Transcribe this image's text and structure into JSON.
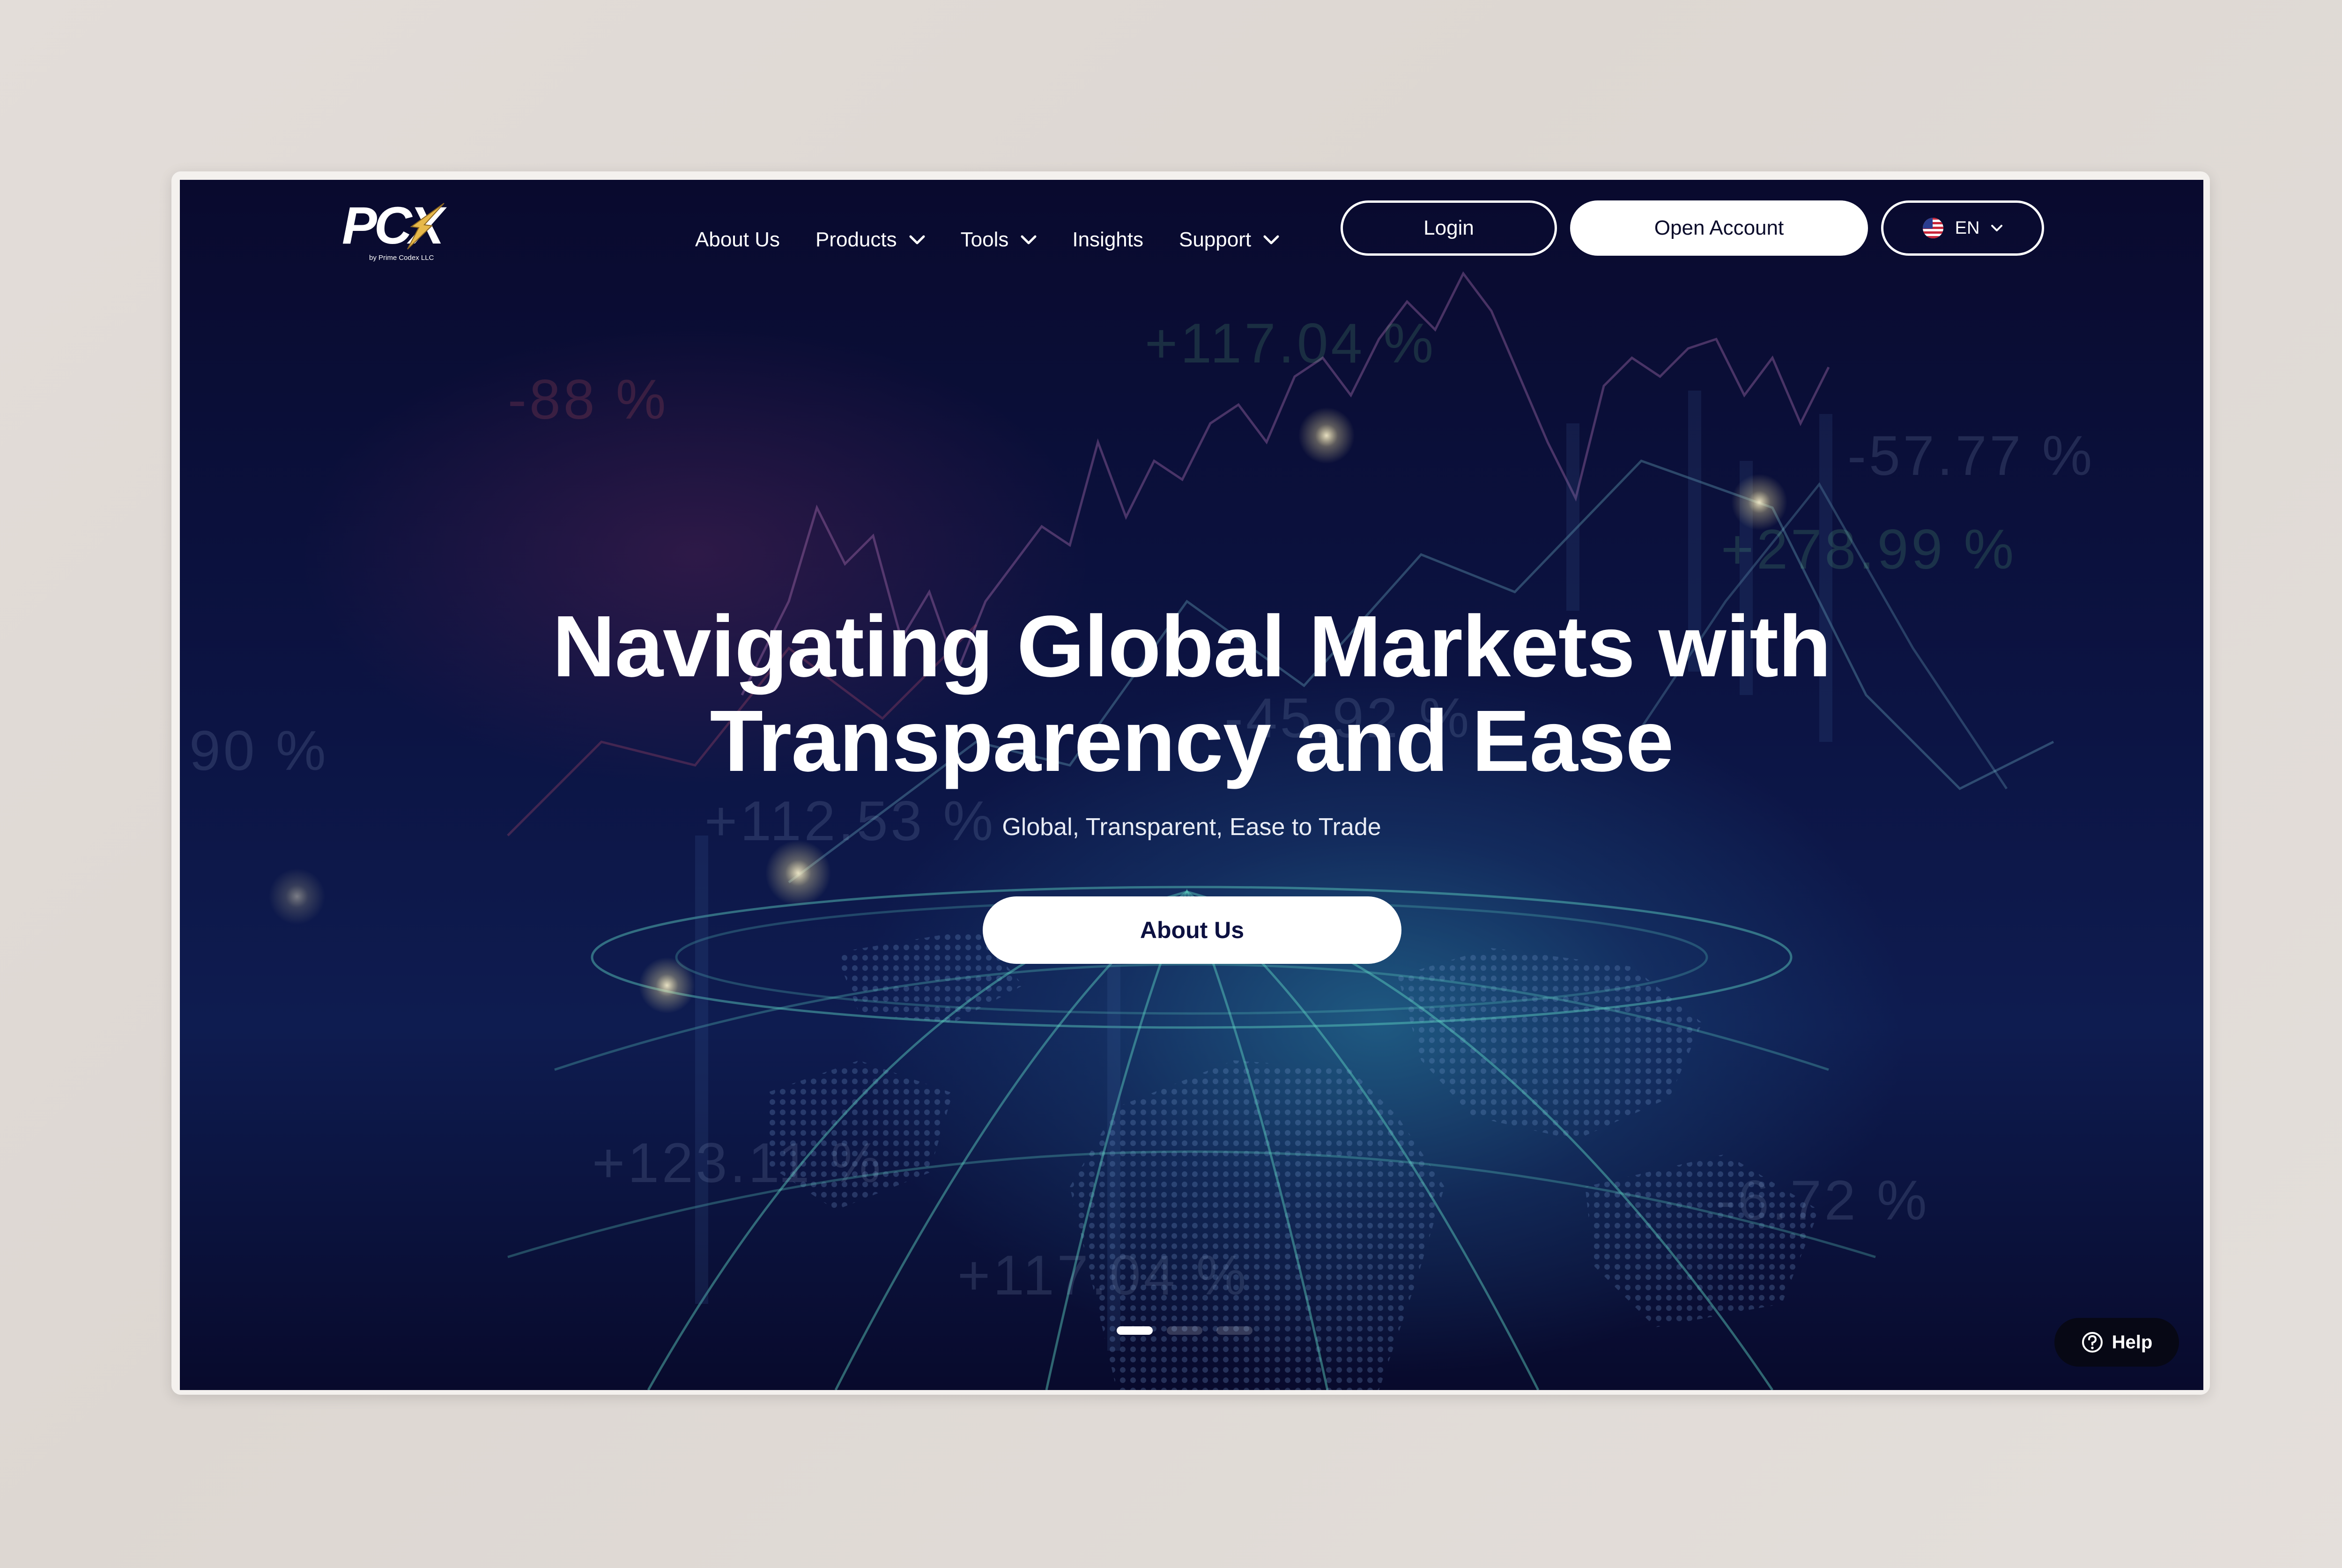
{
  "brand": {
    "logo_text": "PCX",
    "logo_subtitle": "by Prime Codex LLC"
  },
  "nav": {
    "items": [
      {
        "label": "About Us",
        "has_dropdown": false
      },
      {
        "label": "Products",
        "has_dropdown": true
      },
      {
        "label": "Tools",
        "has_dropdown": true
      },
      {
        "label": "Insights",
        "has_dropdown": false
      },
      {
        "label": "Support",
        "has_dropdown": true
      }
    ],
    "login_label": "Login",
    "open_account_label": "Open Account",
    "language": {
      "code": "EN",
      "icon": "us-flag-icon"
    }
  },
  "hero": {
    "title_line1": "Navigating Global Markets with",
    "title_line2": "Transparency and Ease",
    "subtitle": "Global, Transparent, Ease to Trade",
    "cta_label": "About Us"
  },
  "carousel": {
    "slide_count": 3,
    "active_index": 0
  },
  "help": {
    "label": "Help",
    "icon": "question-circle-icon"
  },
  "background_figures": [
    {
      "text": "+117.04 %",
      "tone": "green"
    },
    {
      "text": "-57.77 %",
      "tone": "pale"
    },
    {
      "text": "+278.99 %",
      "tone": "green"
    },
    {
      "text": "+112.53 %",
      "tone": "pale"
    },
    {
      "text": "+123.11 %",
      "tone": "pale"
    },
    {
      "text": "+117.04 %",
      "tone": "pale"
    },
    {
      "text": "-6.72 %",
      "tone": "pale"
    },
    {
      "text": "-88 %",
      "tone": "red"
    },
    {
      "text": "-45.92 %",
      "tone": "pale"
    },
    {
      "text": "90 %",
      "tone": "pale"
    }
  ],
  "colors": {
    "background_deep": "#090a2e",
    "background_glow": "#2c8caa",
    "button_primary_bg": "#ffffff",
    "button_primary_text": "#0a0b2a",
    "help_bg": "#070815"
  }
}
